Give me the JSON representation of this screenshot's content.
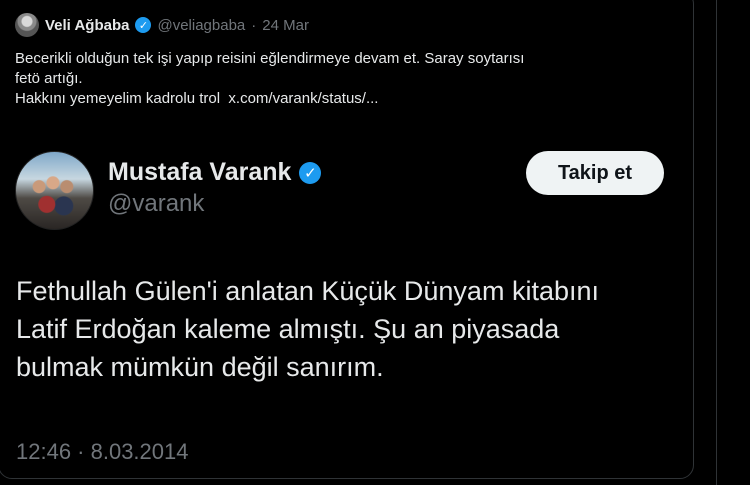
{
  "quoted_tweet": {
    "author_name": "Veli Ağbaba",
    "handle": "@veliagbaba",
    "separator": "·",
    "date": "24 Mar",
    "text_lines": [
      "Becerikli olduğun tek işi yapıp reisini eğlendirmeye devam et. Saray soytarısı",
      "fetö artığı.",
      "Hakkını yemeyelim kadrolu trol"
    ],
    "link": "x.com/varank/status/..."
  },
  "main_tweet": {
    "author_name": "Mustafa Varank",
    "handle": "@varank",
    "follow_label": "Takip et",
    "text_lines": [
      "Fethullah Gülen'i anlatan Küçük Dünyam kitabını",
      "Latif Erdoğan kaleme almıştı. Şu an piyasada",
      "bulmak mümkün değil sanırım."
    ],
    "timestamp": "12:46 · 8.03.2014"
  },
  "colors": {
    "background": "#000000",
    "text": "#e7e9ea",
    "muted": "#71767b",
    "verified": "#1d9bf0",
    "button_bg": "#eff3f4",
    "border": "#2f3336"
  },
  "icons": {
    "verified": "verified-badge-icon"
  }
}
